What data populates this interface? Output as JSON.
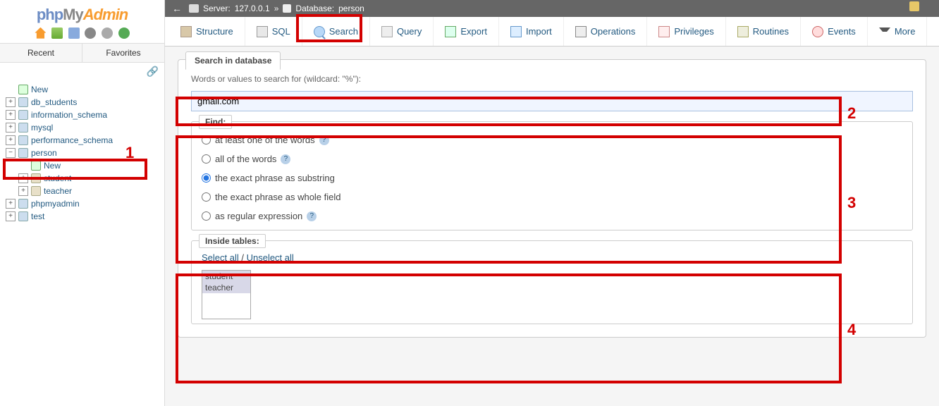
{
  "logo": {
    "p1": "php",
    "p2": "My",
    "p3": "Admin"
  },
  "sidebar_tabs": {
    "recent": "Recent",
    "favorites": "Favorites"
  },
  "tree": {
    "new": "New",
    "db_students": "db_students",
    "information_schema": "information_schema",
    "mysql": "mysql",
    "performance_schema": "performance_schema",
    "person": "person",
    "person_new": "New",
    "student": "student",
    "teacher": "teacher",
    "phpmyadmin": "phpmyadmin",
    "test": "test"
  },
  "breadcrumb": {
    "server_label": "Server:",
    "server_value": "127.0.0.1",
    "separator": "»",
    "db_label": "Database:",
    "db_value": "person"
  },
  "tabs": {
    "structure": "Structure",
    "sql": "SQL",
    "search": "Search",
    "query": "Query",
    "export": "Export",
    "import": "Import",
    "operations": "Operations",
    "privileges": "Privileges",
    "routines": "Routines",
    "events": "Events",
    "more": "More"
  },
  "search_panel": {
    "title": "Search in database",
    "label": "Words or values to search for (wildcard: \"%\"):",
    "value": "gmail.com"
  },
  "find": {
    "legend": "Find:",
    "opt1": "at least one of the words",
    "opt2": "all of the words",
    "opt3": "the exact phrase as substring",
    "opt4": "the exact phrase as whole field",
    "opt5": "as regular expression"
  },
  "inside": {
    "legend": "Inside tables:",
    "select_all": "Select all",
    "slash": " / ",
    "unselect_all": "Unselect all",
    "tables": {
      "t1": "student",
      "t2": "teacher"
    }
  },
  "annotations": {
    "n1": "1",
    "n2": "2",
    "n3": "3",
    "n4": "4"
  }
}
